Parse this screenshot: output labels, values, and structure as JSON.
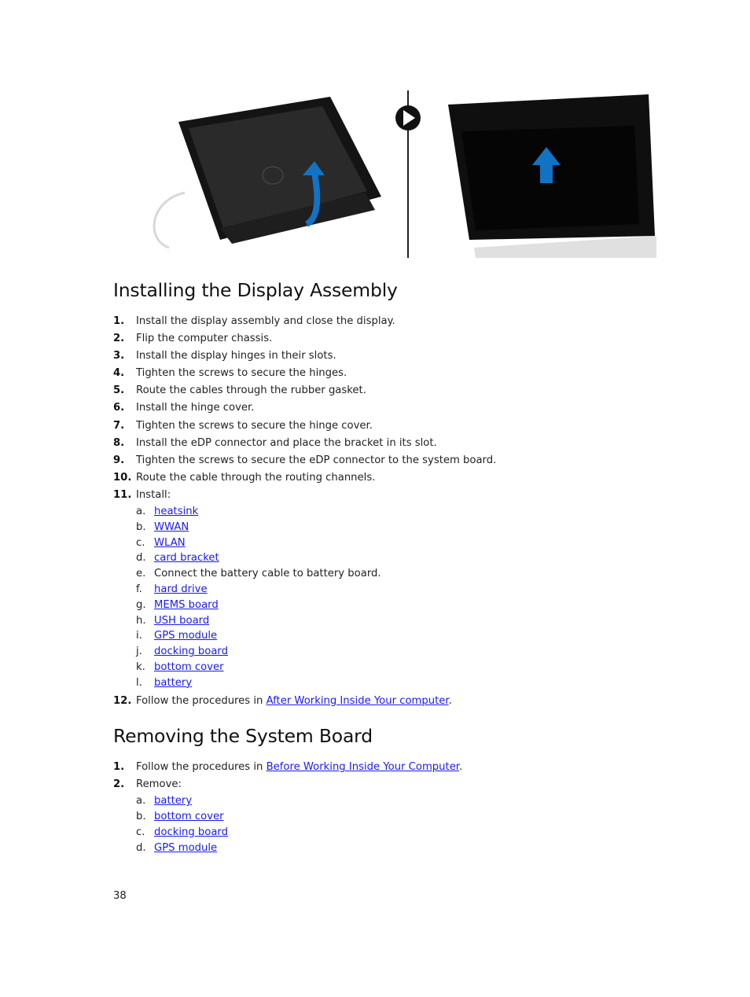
{
  "figure": {
    "left_image": "display-assembly-rotate-up-illustration",
    "divider_icon": "play-arrow-icon",
    "right_image": "display-assembly-lift-illustration",
    "colors": {
      "arrow_blue": "#1273c4",
      "device_black": "#0f0f0f"
    }
  },
  "section1": {
    "title": "Installing the Display Assembly",
    "steps": [
      {
        "num": "1.",
        "text": "Install the display assembly and close the display."
      },
      {
        "num": "2.",
        "text": "Flip the computer chassis."
      },
      {
        "num": "3.",
        "text": "Install the display hinges in their slots."
      },
      {
        "num": "4.",
        "text": "Tighten the screws to secure the hinges."
      },
      {
        "num": "5.",
        "text": "Route the cables through the rubber gasket."
      },
      {
        "num": "6.",
        "text": "Install the hinge cover."
      },
      {
        "num": "7.",
        "text": "Tighten the screws to secure the hinge cover."
      },
      {
        "num": "8.",
        "text": "Install the eDP connector and place the bracket in its slot."
      },
      {
        "num": "9.",
        "text": "Tighten the screws to secure the eDP connector to the system board."
      },
      {
        "num": "10.",
        "text": "Route the cable through the routing channels."
      },
      {
        "num": "11.",
        "text": "Install:"
      }
    ],
    "install_items": [
      {
        "letter": "a.",
        "text": "heatsink",
        "link": true
      },
      {
        "letter": "b.",
        "text": "WWAN",
        "link": true
      },
      {
        "letter": "c.",
        "text": "WLAN",
        "link": true
      },
      {
        "letter": "d.",
        "text": "card bracket",
        "link": true
      },
      {
        "letter": "e.",
        "text": "Connect the battery cable to battery board.",
        "link": false
      },
      {
        "letter": "f.",
        "text": "hard drive",
        "link": true
      },
      {
        "letter": "g.",
        "text": "MEMS board",
        "link": true
      },
      {
        "letter": "h.",
        "text": "USH board",
        "link": true
      },
      {
        "letter": "i.",
        "text": "GPS module",
        "link": true
      },
      {
        "letter": "j.",
        "text": "docking board",
        "link": true
      },
      {
        "letter": "k.",
        "text": "bottom cover",
        "link": true
      },
      {
        "letter": "l.",
        "text": "battery",
        "link": true
      }
    ],
    "step12": {
      "num": "12.",
      "prefix": "Follow the procedures in ",
      "link": "After Working Inside Your computer",
      "suffix": "."
    }
  },
  "section2": {
    "title": "Removing the System Board",
    "step1": {
      "num": "1.",
      "prefix": "Follow the procedures in ",
      "link": "Before Working Inside Your Computer",
      "suffix": "."
    },
    "step2": {
      "num": "2.",
      "text": "Remove:"
    },
    "remove_items": [
      {
        "letter": "a.",
        "text": "battery"
      },
      {
        "letter": "b.",
        "text": "bottom cover"
      },
      {
        "letter": "c.",
        "text": "docking board"
      },
      {
        "letter": "d.",
        "text": "GPS module"
      }
    ]
  },
  "footer": {
    "page_number": "38"
  },
  "link_color": "#1a1aee"
}
